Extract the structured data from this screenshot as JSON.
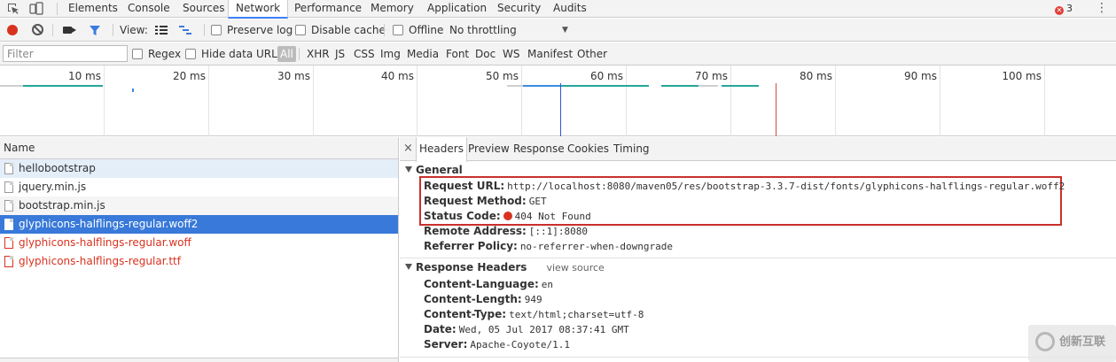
{
  "topbar": {
    "tabs": [
      "Elements",
      "Console",
      "Sources",
      "Network",
      "Performance",
      "Memory",
      "Application",
      "Security",
      "Audits"
    ],
    "active_tab": "Network",
    "error_count": "3"
  },
  "toolbar": {
    "view_label": "View:",
    "preserve_log": "Preserve log",
    "disable_cache": "Disable cache",
    "offline": "Offline",
    "throttling": "No throttling"
  },
  "filterbar": {
    "placeholder": "Filter",
    "regex": "Regex",
    "hide_data_urls": "Hide data URLs",
    "types": [
      "All",
      "XHR",
      "JS",
      "CSS",
      "Img",
      "Media",
      "Font",
      "Doc",
      "WS",
      "Manifest",
      "Other"
    ]
  },
  "overview": {
    "ticks": [
      "10 ms",
      "20 ms",
      "30 ms",
      "40 ms",
      "50 ms",
      "60 ms",
      "70 ms",
      "80 ms",
      "90 ms",
      "100 ms"
    ],
    "colors": {
      "green": "#26a69a",
      "blue": "#3a8de0",
      "marker_blue": "#3255d8",
      "marker_red": "#d04b4b"
    }
  },
  "requests": {
    "column_name": "Name",
    "items": [
      {
        "name": "hellobootstrap",
        "state": "hover"
      },
      {
        "name": "jquery.min.js",
        "state": "normal"
      },
      {
        "name": "bootstrap.min.js",
        "state": "even"
      },
      {
        "name": "glyphicons-halflings-regular.woff2",
        "state": "selected"
      },
      {
        "name": "glyphicons-halflings-regular.woff",
        "state": "failed"
      },
      {
        "name": "glyphicons-halflings-regular.ttf",
        "state": "failed"
      }
    ]
  },
  "details": {
    "close_glyph": "×",
    "tabs": [
      "Headers",
      "Preview",
      "Response",
      "Cookies",
      "Timing"
    ],
    "active_tab": "Headers",
    "general": {
      "title": "General",
      "request_url_key": "Request URL:",
      "request_url": "http://localhost:8080/maven05/res/bootstrap-3.3.7-dist/fonts/glyphicons-halflings-regular.woff2",
      "request_method_key": "Request Method:",
      "request_method": "GET",
      "status_code_key": "Status Code:",
      "status_code": "404 Not Found",
      "remote_address_key": "Remote Address:",
      "remote_address": "[::1]:8080",
      "referrer_policy_key": "Referrer Policy:",
      "referrer_policy": "no-referrer-when-downgrade"
    },
    "response_headers": {
      "title": "Response Headers",
      "view_source": "view source",
      "rows": [
        {
          "key": "Content-Language:",
          "value": "en"
        },
        {
          "key": "Content-Length:",
          "value": "949"
        },
        {
          "key": "Content-Type:",
          "value": "text/html;charset=utf-8"
        },
        {
          "key": "Date:",
          "value": "Wed, 05 Jul 2017 08:37:41 GMT"
        },
        {
          "key": "Server:",
          "value": "Apache-Coyote/1.1"
        }
      ]
    }
  },
  "watermark": {
    "text": "创新互联"
  }
}
